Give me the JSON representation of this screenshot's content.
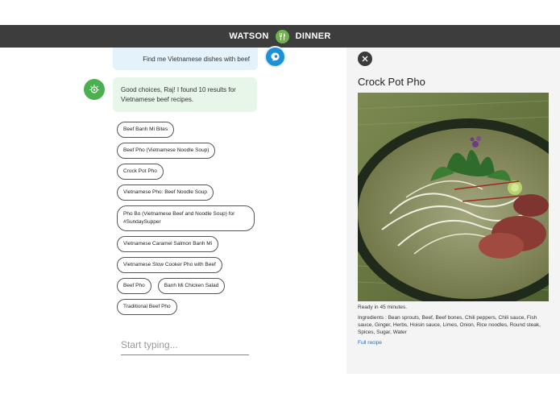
{
  "header": {
    "left_word": "WATSON",
    "right_word": "DINNER"
  },
  "chat": {
    "user_message": "Find me Vietnamese dishes with beef",
    "bot_message": "Good choices, Raj! I found 10 results for Vietnamese beef recipes.",
    "results": [
      "Beef Banh Mi Bites",
      "Beef Pho (Vietnamese Noodle Soup)",
      "Crock Pot Pho",
      "Vietnamese Pho: Beef Noodle Soup",
      "Pho Bo (Vietnamese Beef and Noodle Soup) for #SundaySupper",
      "Vietnamese Caramel Salmon Banh Mi",
      "Vietnamese Slow Cooker Pho with Beef",
      "Beef Pho",
      "Banh Mi Chicken Salad",
      "Traditional Beef Pho"
    ],
    "input_placeholder": "Start typing..."
  },
  "recipe": {
    "title": "Crock Pot Pho",
    "ready": "Ready in 45 minutes.",
    "ingredients": "Ingredients : Bean sprouts, Beef, Beef bones, Chili peppers, Chili sauce, Fish sauce, Ginger, Herbs, Hoisin sauce, Limes, Onion, Rice noodles, Round steak, Spices, Sugar, Water",
    "link": "Full recipe"
  },
  "colors": {
    "header_bg": "#3d3d3d",
    "accent_green": "#4caf50",
    "user_blue": "#1e90d8",
    "link_blue": "#1e6fb8"
  },
  "icons": {
    "logo": "fork-knife-icon",
    "user": "user-bubble-icon",
    "bot": "watson-bot-icon",
    "close": "close-icon"
  }
}
